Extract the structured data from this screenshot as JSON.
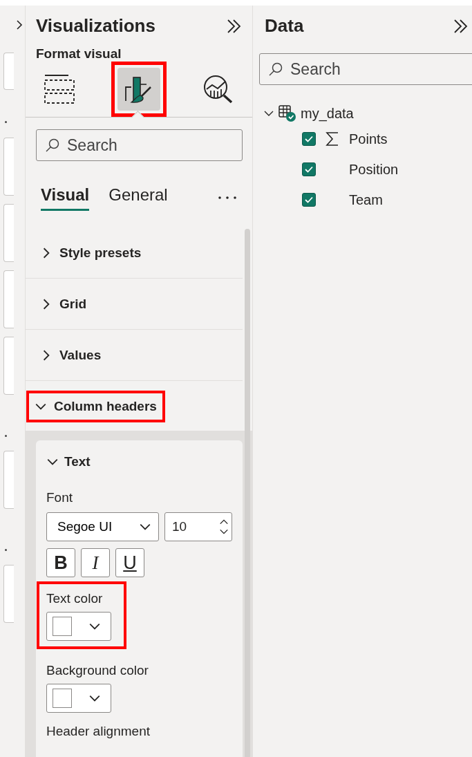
{
  "visualizations": {
    "title": "Visualizations",
    "subtitle": "Format visual",
    "view_buttons": [
      {
        "kind": "build",
        "selected": false,
        "highlighted": false
      },
      {
        "kind": "format",
        "selected": true,
        "highlighted": true
      },
      {
        "kind": "analytics",
        "selected": false,
        "highlighted": false
      }
    ],
    "search": {
      "placeholder": "Search"
    },
    "tabs": [
      {
        "label": "Visual",
        "selected": true
      },
      {
        "label": "General",
        "selected": false
      }
    ],
    "sections": [
      {
        "label": "Style presets",
        "expanded": false,
        "highlighted": false
      },
      {
        "label": "Grid",
        "expanded": false,
        "highlighted": false
      },
      {
        "label": "Values",
        "expanded": false,
        "highlighted": false
      },
      {
        "label": "Column headers",
        "expanded": true,
        "highlighted": true
      }
    ],
    "card": {
      "title": "Text",
      "expanded": true,
      "font_label": "Font",
      "font_family": "Segoe UI",
      "font_size": "10",
      "style_buttons": [
        {
          "label": "B",
          "kind": "bold"
        },
        {
          "label": "I",
          "kind": "italic"
        },
        {
          "label": "U",
          "kind": "underline"
        }
      ],
      "color_fields": [
        {
          "label": "Text color",
          "highlighted": true
        },
        {
          "label": "Background color",
          "highlighted": false
        }
      ],
      "next_label": "Header alignment"
    }
  },
  "data": {
    "title": "Data",
    "search": {
      "placeholder": "Search"
    },
    "tables": [
      {
        "name": "my_data",
        "expanded": true,
        "fields": [
          {
            "name": "Points",
            "checked": true,
            "kind": "measure"
          },
          {
            "name": "Position",
            "checked": true,
            "kind": "text"
          },
          {
            "name": "Team",
            "checked": true,
            "kind": "text"
          }
        ]
      }
    ]
  }
}
